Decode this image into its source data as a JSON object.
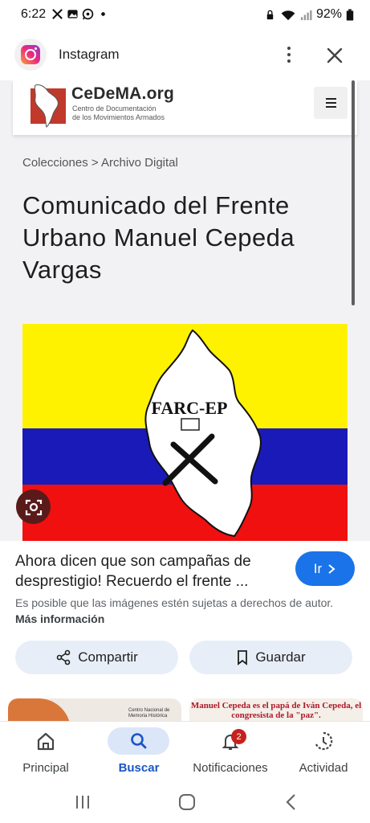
{
  "status_bar": {
    "time": "6:22",
    "battery": "92%"
  },
  "app_header": {
    "title": "Instagram"
  },
  "site": {
    "name": "CeDeMA.org",
    "subtitle_line1": "Centro de Documentación",
    "subtitle_line2": "de los Movimientos Armados",
    "breadcrumb": "Colecciones > Archivo Digital",
    "page_title": "Comunicado del Frente Urbano Manuel Cepeda Vargas",
    "image_text": "FARC-EP",
    "flag_colors": {
      "yellow": "#fff200",
      "blue": "#1a1ab8",
      "red": "#f01010"
    }
  },
  "result": {
    "title": "Ahora dicen que son campañas de desprestigio! Recuerdo el frente ...",
    "go_label": "Ir",
    "copyright_text": "Es posible que las imágenes estén sujetas a derechos de autor.",
    "copyright_link": "Más información",
    "share_label": "Compartir",
    "save_label": "Guardar"
  },
  "thumbnails": {
    "thumb1_text": "Centro Nacional de Memoria Histórica",
    "thumb2_text": "Manuel Cepeda es el papá de Iván Cepeda, el congresista de la \"paz\"."
  },
  "bottom_nav": {
    "principal": "Principal",
    "buscar": "Buscar",
    "notificaciones": "Notificaciones",
    "notif_badge": "2",
    "actividad": "Actividad"
  },
  "colors": {
    "accent": "#1a73e8",
    "pill_bg": "#e8eef8",
    "badge": "#c5221f"
  }
}
